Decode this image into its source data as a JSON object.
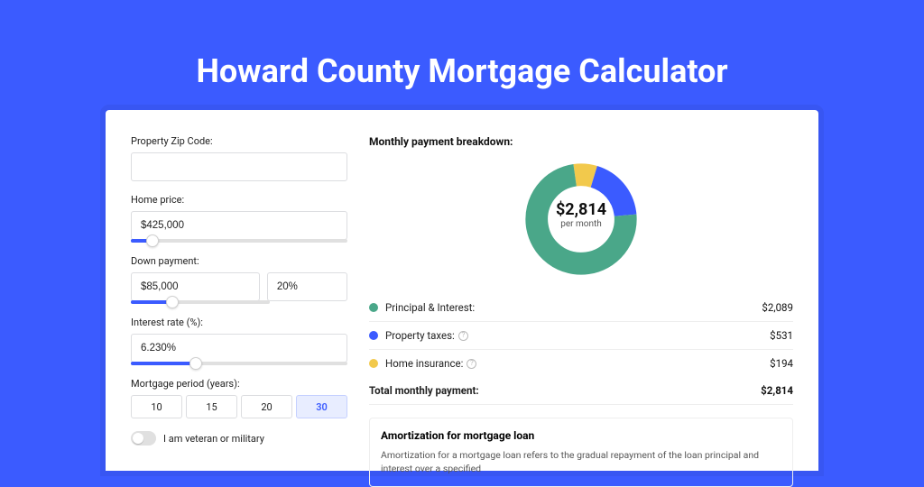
{
  "title": "Howard County Mortgage Calculator",
  "form": {
    "zip": {
      "label": "Property Zip Code:",
      "value": ""
    },
    "home_price": {
      "label": "Home price:",
      "value": "$425,000",
      "slider_pct": 10
    },
    "down_payment": {
      "label": "Down payment:",
      "amount": "$85,000",
      "percent": "20%",
      "slider_pct": 20
    },
    "interest_rate": {
      "label": "Interest rate (%):",
      "value": "6.230%",
      "slider_pct": 30
    },
    "period": {
      "label": "Mortgage period (years):",
      "options": [
        "10",
        "15",
        "20",
        "30"
      ],
      "selected": "30"
    },
    "veteran": {
      "label": "I am veteran or military",
      "checked": false
    }
  },
  "breakdown": {
    "title": "Monthly payment breakdown:",
    "center_amount": "$2,814",
    "center_sub": "per month",
    "items": [
      {
        "label": "Principal & Interest:",
        "value": "$2,089",
        "color": "#4aa789",
        "pct": 74.2,
        "info": false
      },
      {
        "label": "Property taxes:",
        "value": "$531",
        "color": "#3b5bff",
        "pct": 18.9,
        "info": true
      },
      {
        "label": "Home insurance:",
        "value": "$194",
        "color": "#f2c94c",
        "pct": 6.9,
        "info": true
      }
    ],
    "total_label": "Total monthly payment:",
    "total_value": "$2,814"
  },
  "amortization": {
    "title": "Amortization for mortgage loan",
    "text": "Amortization for a mortgage loan refers to the gradual repayment of the loan principal and interest over a specified"
  },
  "chart_data": {
    "type": "pie",
    "title": "Monthly payment breakdown",
    "series": [
      {
        "name": "Principal & Interest",
        "value": 2089,
        "color": "#4aa789"
      },
      {
        "name": "Property taxes",
        "value": 531,
        "color": "#3b5bff"
      },
      {
        "name": "Home insurance",
        "value": 194,
        "color": "#f2c94c"
      }
    ],
    "total": 2814,
    "center_label": "$2,814 per month"
  }
}
